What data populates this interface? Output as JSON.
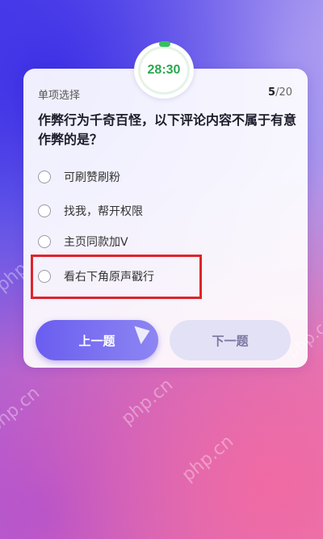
{
  "timer": {
    "value": "28:30"
  },
  "question_header": {
    "type_label": "单项选择",
    "current": "5",
    "total": "/20"
  },
  "question": {
    "text": "作弊行为千奇百怪，以下评论内容不属于有意作弊的是？"
  },
  "options": [
    {
      "label": "可刷赞刷粉"
    },
    {
      "label": "找我，帮开权限"
    },
    {
      "label": "主页同款加V"
    },
    {
      "label": "看右下角原声戳行"
    }
  ],
  "highlighted_option_index": 3,
  "buttons": {
    "prev_label": "上一题",
    "next_label": "下一题"
  },
  "watermark": {
    "text": "php.cn"
  },
  "colors": {
    "timer_green": "#2aa84f",
    "primary_button": "#6a5df0",
    "highlight_border": "#e0232a"
  }
}
